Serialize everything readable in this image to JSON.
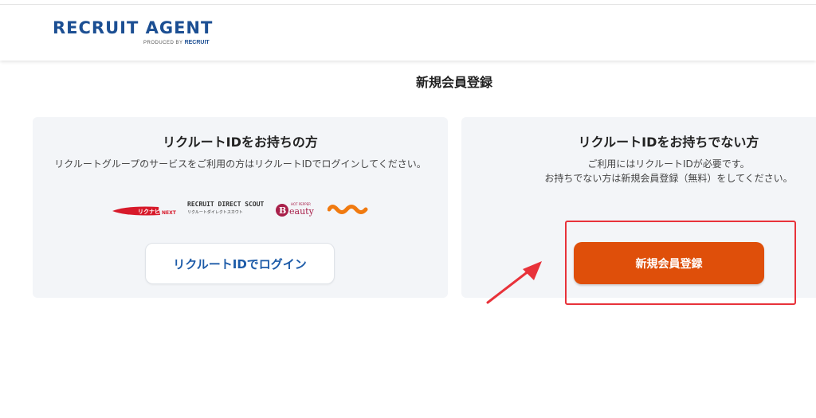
{
  "header": {
    "logo_text": "RECRUIT AGENT",
    "logo_sub_prefix": "PRODUCED BY",
    "logo_sub_brand": "RECRUIT"
  },
  "page": {
    "title": "新規会員登録"
  },
  "left_card": {
    "title": "リクルートIDをお持ちの方",
    "description": "リクルートグループのサービスをご利用の方はリクルートIDでログインしてください。",
    "brands": {
      "rikunabi": "リクナビNEXT",
      "rds_line1": "RECRUIT DIRECT SCOUT",
      "rds_line2": "リクルートダイレクトスカウト",
      "beauty_top": "HOT PEPPER",
      "beauty": "Beauty",
      "jaran": "じゃらん"
    },
    "login_label": "リクルートIDでログイン"
  },
  "right_card": {
    "title": "リクルートIDをお持ちでない方",
    "description_line1": "ご利用にはリクルートIDが必要です。",
    "description_line2": "お持ちでない方は新規会員登録（無料）をしてください。",
    "register_label": "新規会員登録"
  },
  "colors": {
    "brand_blue": "#1c4f93",
    "register_orange": "#df4f0a",
    "annotation_red": "#e8323a",
    "card_bg": "#f3f5f8"
  }
}
